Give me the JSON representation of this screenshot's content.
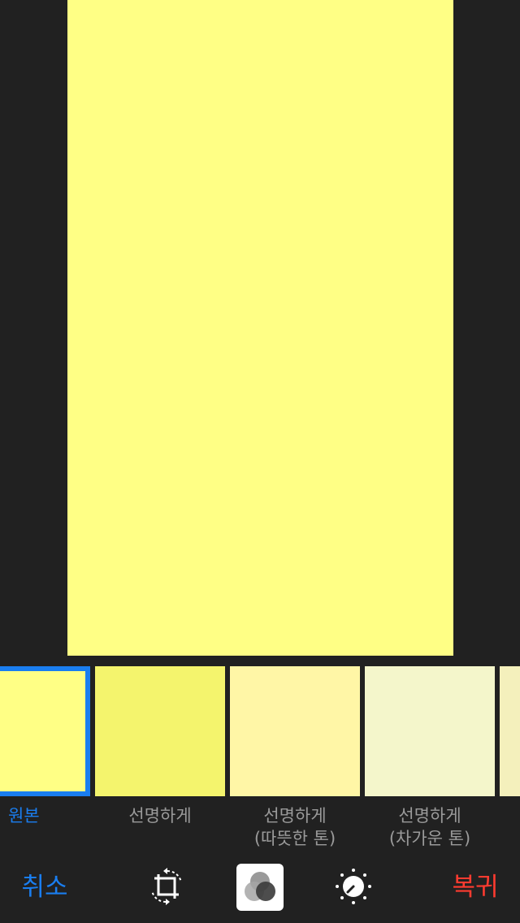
{
  "photo": {
    "fill_color": "#ffff85"
  },
  "filters": [
    {
      "label_line1": "원본",
      "label_line2": "",
      "color": "#ffff85",
      "selected": true
    },
    {
      "label_line1": "선명하게",
      "label_line2": "",
      "color": "#f4f46d",
      "selected": false
    },
    {
      "label_line1": "선명하게",
      "label_line2": "(따뜻한 톤)",
      "color": "#fff6a6",
      "selected": false
    },
    {
      "label_line1": "선명하게",
      "label_line2": "(차가운 톤)",
      "color": "#f4f6cb",
      "selected": false
    },
    {
      "label_line1": "",
      "label_line2": "",
      "color": "#f4f0bc",
      "selected": false
    }
  ],
  "toolbar": {
    "cancel_label": "취소",
    "revert_label": "복귀",
    "cancel_color": "#1a7ef0",
    "revert_color": "#ff3b30",
    "icons": [
      "crop-rotate-icon",
      "filters-icon",
      "adjust-dial-icon"
    ]
  },
  "colors": {
    "background": "#212121",
    "accent": "#1a7ef0",
    "label_gray": "#9a9a9a"
  }
}
